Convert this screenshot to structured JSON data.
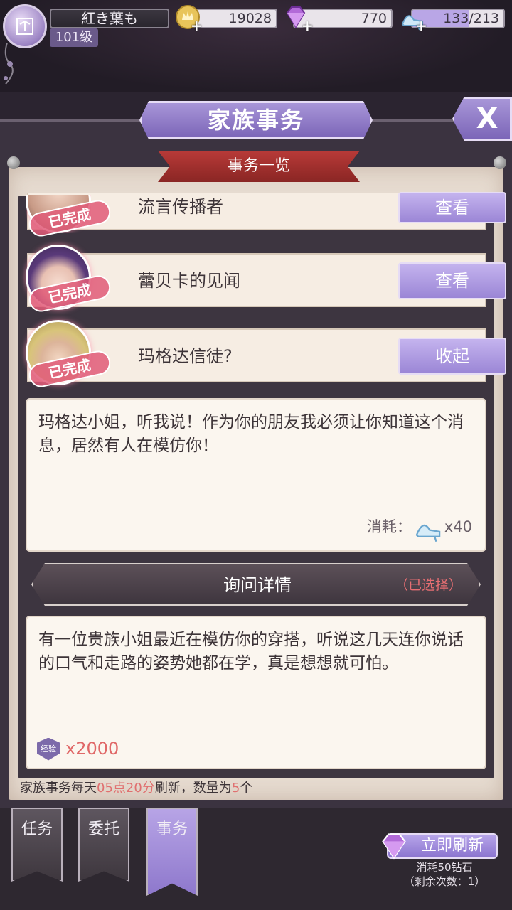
{
  "player": {
    "name": "紅き葉も",
    "level": "101级"
  },
  "resources": {
    "gold": "19028",
    "diamond": "770",
    "stamina": "133/213"
  },
  "header": {
    "title": "家族事务",
    "close_label": "X",
    "ribbon": "事务一览"
  },
  "tasks": [
    {
      "title": "流言传播者",
      "status": "已完成",
      "button": "查看"
    },
    {
      "title": "蕾贝卡的见闻",
      "status": "已完成",
      "button": "查看"
    },
    {
      "title": "玛格达信徒?",
      "status": "已完成",
      "button": "收起"
    }
  ],
  "message": {
    "text": "玛格达小姐，听我说！作为你的朋友我必须让你知道这个消息，居然有人在模仿你！",
    "cost_label": "消耗：",
    "cost_value": "x40"
  },
  "option": {
    "label": "询问详情",
    "status": "（已选择）"
  },
  "reply": {
    "text": "有一位贵族小姐最近在模仿你的穿搭，听说这几天连你说话的口气和走路的姿势她都在学，真是想想就可怕。",
    "exp_badge": "经验",
    "exp_value": "x2000"
  },
  "footer": {
    "prefix": "家族事务每天",
    "time": "05点20分",
    "middle": "刷新，数量为",
    "count": "5",
    "suffix": "个"
  },
  "bottom_tabs": [
    {
      "label": "任务"
    },
    {
      "label": "委托"
    },
    {
      "label": "事务"
    }
  ],
  "refresh": {
    "label": "立即刷新",
    "cost": "消耗50钻石",
    "remaining": "（剩余次数：1）"
  },
  "colors": {
    "accent_purple": "#9b86d6",
    "ribbon_red": "#a8302e",
    "highlight_red": "#e07070"
  }
}
